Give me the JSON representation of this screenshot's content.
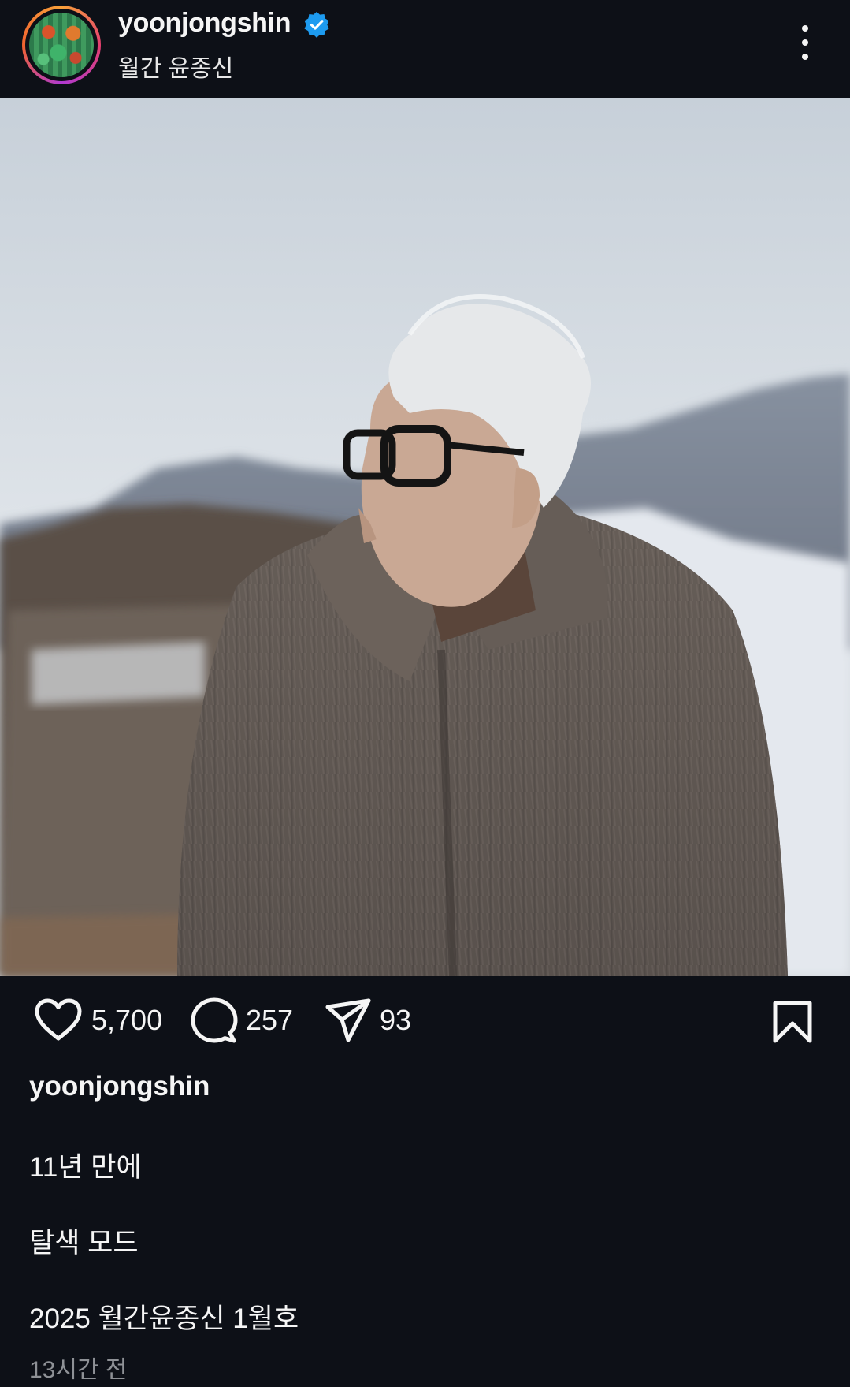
{
  "header": {
    "username": "yoonjongshin",
    "verified": true,
    "subtitle": "월간 윤종신",
    "icons": {
      "avatar": "profile-avatar",
      "verified": "verified-badge-icon",
      "more": "more-options-icon"
    }
  },
  "post": {
    "image_alt": "Man with white hair, black glasses and grey fur coat in snowy mountains"
  },
  "actions": {
    "likes": "5,700",
    "comments": "257",
    "shares": "93",
    "icons": {
      "like": "heart-icon",
      "comment": "comment-icon",
      "share": "send-icon",
      "save": "bookmark-icon"
    }
  },
  "caption": {
    "username": "yoonjongshin",
    "lines": [
      "11년 만에",
      "탈색 모드",
      "2025 월간윤종신 1월호"
    ],
    "timestamp": "13시간 전"
  },
  "colors": {
    "background": "#0d1017",
    "text": "#f5f5f5",
    "muted": "#8e9196",
    "verified": "#1d9bf0"
  }
}
